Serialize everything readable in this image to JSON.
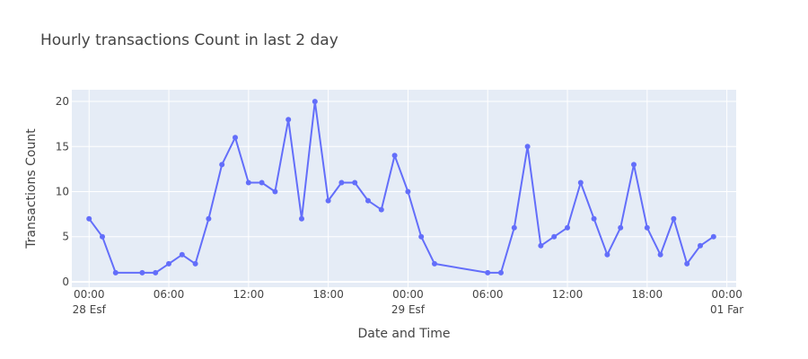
{
  "chart_data": {
    "type": "line",
    "title": "Hourly transactions Count in last 2 day",
    "xlabel": "Date and Time",
    "ylabel": "Transactions Count",
    "x_unit": "hour",
    "x_range_hours": [
      -1.3,
      48.7
    ],
    "ylim": [
      -0.6,
      21.3
    ],
    "y_ticks": [
      0,
      5,
      10,
      15,
      20
    ],
    "x_ticks": [
      {
        "h": 0,
        "time": "00:00",
        "date": "28 Esf"
      },
      {
        "h": 6,
        "time": "06:00",
        "date": ""
      },
      {
        "h": 12,
        "time": "12:00",
        "date": ""
      },
      {
        "h": 18,
        "time": "18:00",
        "date": ""
      },
      {
        "h": 24,
        "time": "00:00",
        "date": "29 Esf"
      },
      {
        "h": 30,
        "time": "06:00",
        "date": ""
      },
      {
        "h": 36,
        "time": "12:00",
        "date": ""
      },
      {
        "h": 42,
        "time": "18:00",
        "date": ""
      },
      {
        "h": 48,
        "time": "00:00",
        "date": "01 Far"
      }
    ],
    "grid": true,
    "colors": {
      "line": "#636efa",
      "plot_bg": "#e5ecf6",
      "grid": "#ffffff"
    },
    "series": [
      {
        "x": [
          "28 Esf 00:00",
          "28 Esf 01:00",
          "28 Esf 02:00",
          "28 Esf 04:00",
          "28 Esf 05:00",
          "28 Esf 06:00",
          "28 Esf 07:00",
          "28 Esf 08:00",
          "28 Esf 09:00",
          "28 Esf 10:00",
          "28 Esf 11:00",
          "28 Esf 12:00",
          "28 Esf 13:00",
          "28 Esf 14:00",
          "28 Esf 15:00",
          "28 Esf 16:00",
          "28 Esf 17:00",
          "28 Esf 18:00",
          "28 Esf 19:00",
          "28 Esf 20:00",
          "28 Esf 21:00",
          "28 Esf 22:00",
          "28 Esf 23:00",
          "29 Esf 00:00",
          "29 Esf 01:00",
          "29 Esf 02:00",
          "29 Esf 06:00",
          "29 Esf 07:00",
          "29 Esf 08:00",
          "29 Esf 09:00",
          "29 Esf 10:00",
          "29 Esf 11:00",
          "29 Esf 12:00",
          "29 Esf 13:00",
          "29 Esf 14:00",
          "29 Esf 15:00",
          "29 Esf 16:00",
          "29 Esf 17:00",
          "29 Esf 18:00",
          "29 Esf 19:00",
          "29 Esf 20:00",
          "29 Esf 21:00",
          "29 Esf 22:00",
          "29 Esf 23:00"
        ],
        "x_hours": [
          0,
          1,
          2,
          4,
          5,
          6,
          7,
          8,
          9,
          10,
          11,
          12,
          13,
          14,
          15,
          16,
          17,
          18,
          19,
          20,
          21,
          22,
          23,
          24,
          25,
          26,
          30,
          31,
          32,
          33,
          34,
          35,
          36,
          37,
          38,
          39,
          40,
          41,
          42,
          43,
          44,
          45,
          46,
          47
        ],
        "y": [
          7,
          5,
          1,
          1,
          1,
          2,
          3,
          2,
          7,
          13,
          16,
          11,
          11,
          10,
          18,
          7,
          20,
          9,
          11,
          11,
          9,
          8,
          14,
          10,
          5,
          2,
          1,
          1,
          6,
          15,
          4,
          5,
          6,
          11,
          7,
          3,
          6,
          13,
          6,
          3,
          7,
          2,
          4,
          5
        ]
      }
    ]
  }
}
